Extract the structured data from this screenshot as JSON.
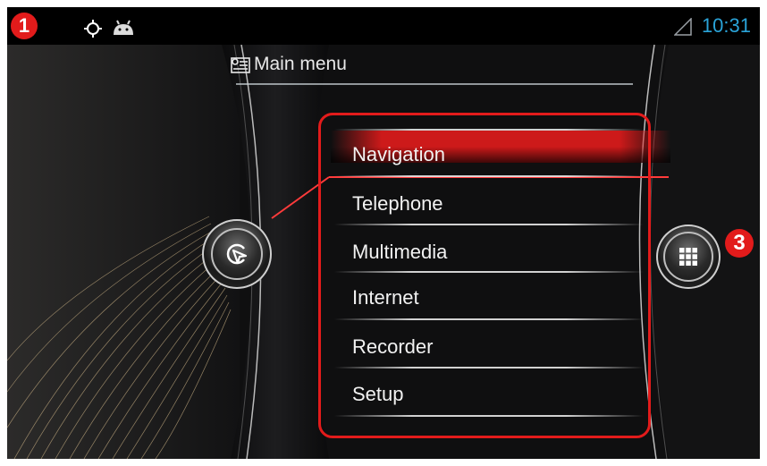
{
  "status_bar": {
    "badge_left": "1",
    "icons": [
      "gps-icon",
      "android-icon"
    ],
    "signal_icon": "signal-icon",
    "time": "10:31",
    "time_color": "#2aa3d8"
  },
  "header": {
    "icon": "menu-list-icon",
    "title": "Main menu"
  },
  "menu": {
    "items": [
      {
        "label": "Navigation",
        "selected": true
      },
      {
        "label": "Telephone",
        "selected": false
      },
      {
        "label": "Multimedia",
        "selected": false
      },
      {
        "label": "Internet",
        "selected": false
      },
      {
        "label": "Recorder",
        "selected": false
      },
      {
        "label": "Setup",
        "selected": false
      }
    ],
    "highlight_color": "#e21b1b"
  },
  "buttons": {
    "left_icon": "navigation-target-icon",
    "right_icon": "apps-grid-icon",
    "badge_right": "3"
  },
  "colors": {
    "accent": "#e21b1b",
    "background": "#0c0c0d",
    "text": "#f2f2f2"
  }
}
